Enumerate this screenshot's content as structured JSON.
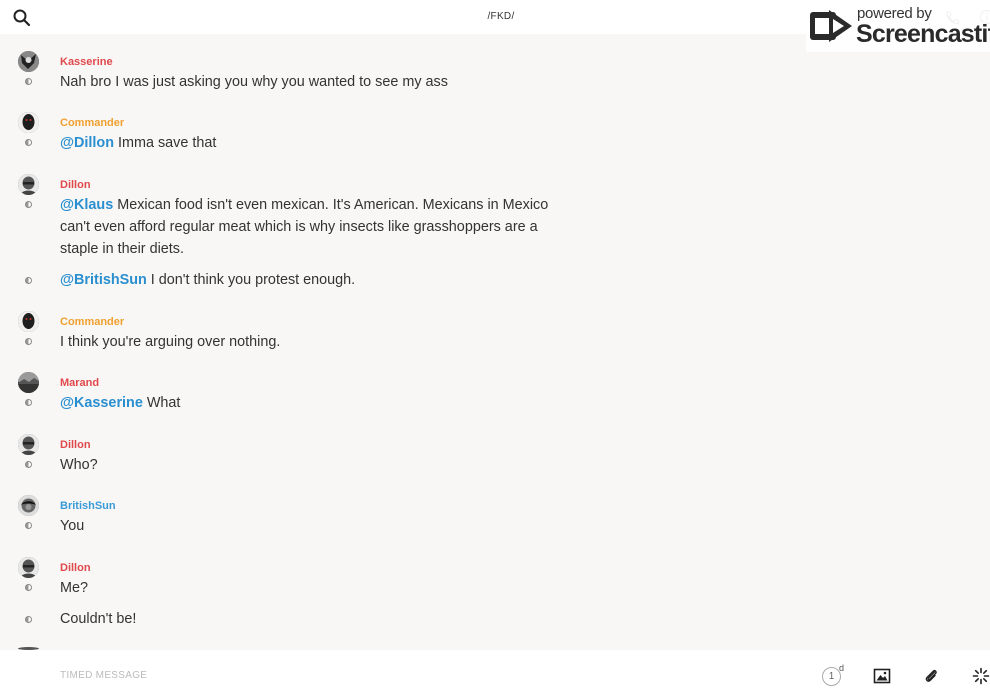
{
  "header": {
    "channel_title": "/FKD/"
  },
  "watermark": {
    "powered_by": "powered by",
    "brand": "Screencastify"
  },
  "colors": {
    "mention": "#2a8fd0",
    "author_red": "#e0484c",
    "author_orange": "#f0a030",
    "author_blue": "#3a9ad8"
  },
  "messages": [
    {
      "author": "Kasserine",
      "author_color": "#e0484c",
      "avatar": "avatar-kasserine",
      "mention": "",
      "text": "Nah bro I was just asking you why you wanted to see my ass"
    },
    {
      "author": "Commander",
      "author_color": "#f0a030",
      "avatar": "avatar-commander",
      "mention": "@Dillon",
      "text": " Imma save that"
    },
    {
      "author": "Dillon",
      "author_color": "#e0484c",
      "avatar": "avatar-dillon",
      "mention": "@Klaus",
      "text": " Mexican food isn't even mexican. It's American. Mexicans in Mexico can't even afford regular meat which is why insects like grasshoppers are a staple in their diets."
    },
    {
      "author": "",
      "author_color": "",
      "avatar": "",
      "mention": "@BritishSun",
      "text": " I don't think you protest enough."
    },
    {
      "author": "Commander",
      "author_color": "#f0a030",
      "avatar": "avatar-commander",
      "mention": "",
      "text": "I think you're arguing over nothing."
    },
    {
      "author": "Marand",
      "author_color": "#e0484c",
      "avatar": "avatar-marand",
      "mention": "@Kasserine",
      "text": " What"
    },
    {
      "author": "Dillon",
      "author_color": "#e0484c",
      "avatar": "avatar-dillon",
      "mention": "",
      "text": "Who?"
    },
    {
      "author": "BritishSun",
      "author_color": "#3a9ad8",
      "avatar": "avatar-britishsun",
      "mention": "",
      "text": "You"
    },
    {
      "author": "Dillon",
      "author_color": "#e0484c",
      "avatar": "avatar-dillon",
      "mention": "",
      "text": "Me?"
    },
    {
      "author": "",
      "author_color": "",
      "avatar": "",
      "mention": "",
      "text": "Couldn't be!"
    }
  ],
  "composer": {
    "placeholder": "TIMED MESSAGE",
    "timer_value": "1",
    "timer_unit": "d"
  },
  "icons": {
    "search": "search-icon",
    "phone": "phone-icon",
    "info": "info-icon",
    "image": "image-icon",
    "attach": "paperclip-icon",
    "more": "sparkle-icon"
  }
}
